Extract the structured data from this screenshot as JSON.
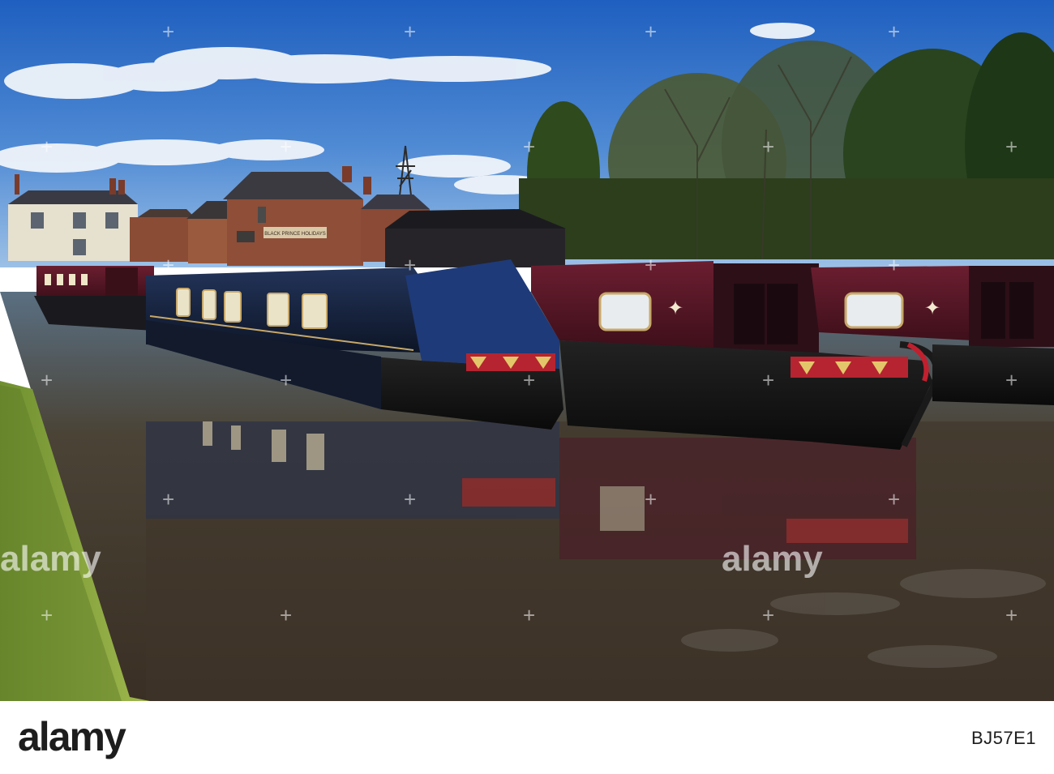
{
  "photo": {
    "subject": "",
    "sign_text": "BLACK PRINCE HOLIDAYS"
  },
  "watermark": {
    "brand": "alamy",
    "repeat_mark": "+"
  },
  "footer": {
    "brand": "alamy",
    "image_id": "BJ57E1",
    "background": "#ffffff",
    "text_color": "#1d1d1d"
  },
  "colors": {
    "sky": "#2f6fc6",
    "water": "#463a2c",
    "boat_navy": "#1d2a48",
    "boat_maroon": "#5a1726",
    "grass": "#7d9a3a"
  }
}
